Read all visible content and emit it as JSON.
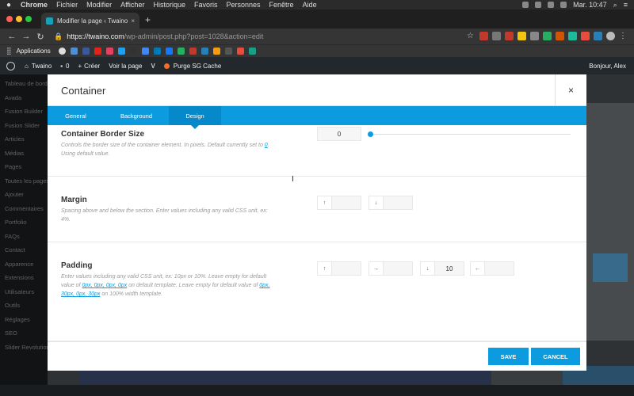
{
  "os_menu": {
    "app": "Chrome",
    "items": [
      "Fichier",
      "Modifier",
      "Afficher",
      "Historique",
      "Favoris",
      "Personnes",
      "Fenêtre",
      "Aide"
    ],
    "clock": "Mar. 10:47"
  },
  "browser": {
    "tab_title": "Modifier la page ‹ Twaino — W",
    "url_prefix": "https://twaino.com",
    "url_path": "/wp-admin/post.php?post=1028&action=edit",
    "bookmarks_label": "Applications"
  },
  "wp_bar": {
    "site": "Twaino",
    "comments": "0",
    "new": "Créer",
    "view": "Voir la page",
    "cache": "Purge SG Cache",
    "greeting": "Bonjour, Alex"
  },
  "wp_sidebar": [
    "Tableau de bord",
    "Avada",
    "Fusion Builder",
    "Fusion Slider",
    "Articles",
    "Médias",
    "Pages",
    "Toutes les pages",
    "Ajouter",
    "Commentaires",
    "Portfolio",
    "FAQs",
    "Contact",
    "Apparence",
    "Extensions",
    "Utilisateurs",
    "Outils",
    "Réglages",
    "SEO",
    "Slider Revolution"
  ],
  "modal": {
    "title": "Container",
    "close": "×",
    "tabs": [
      "General",
      "Background",
      "Design"
    ],
    "active_tab": "Design",
    "border_size": {
      "title": "Container Border Size",
      "desc_a": "Controls the border size of the container element. In pixels. Default currently set to ",
      "desc_link": "0",
      "desc_b": ". Using default value.",
      "value": "0"
    },
    "margin": {
      "title": "Margin",
      "desc": "Spacing above and below the section. Enter values including any valid CSS unit, ex: 4%.",
      "top": "",
      "bottom": ""
    },
    "padding": {
      "title": "Padding",
      "desc_a": "Enter values including any valid CSS unit, ex: 10px or 10%. Leave empty for default value of ",
      "desc_link1": "0px, 0px, 0px, 0px",
      "desc_b": " on default template. Leave empty for default value of ",
      "desc_link2": "0px, 30px, 0px, 30px",
      "desc_c": " on 100% width template.",
      "top": "",
      "right": "",
      "bottom": "10",
      "left": ""
    },
    "save": "SAVE",
    "cancel": "CANCEL"
  },
  "colors": {
    "accent": "#0c9bde",
    "active_tab": "#0689cb",
    "wp_bar": "#23282d"
  }
}
